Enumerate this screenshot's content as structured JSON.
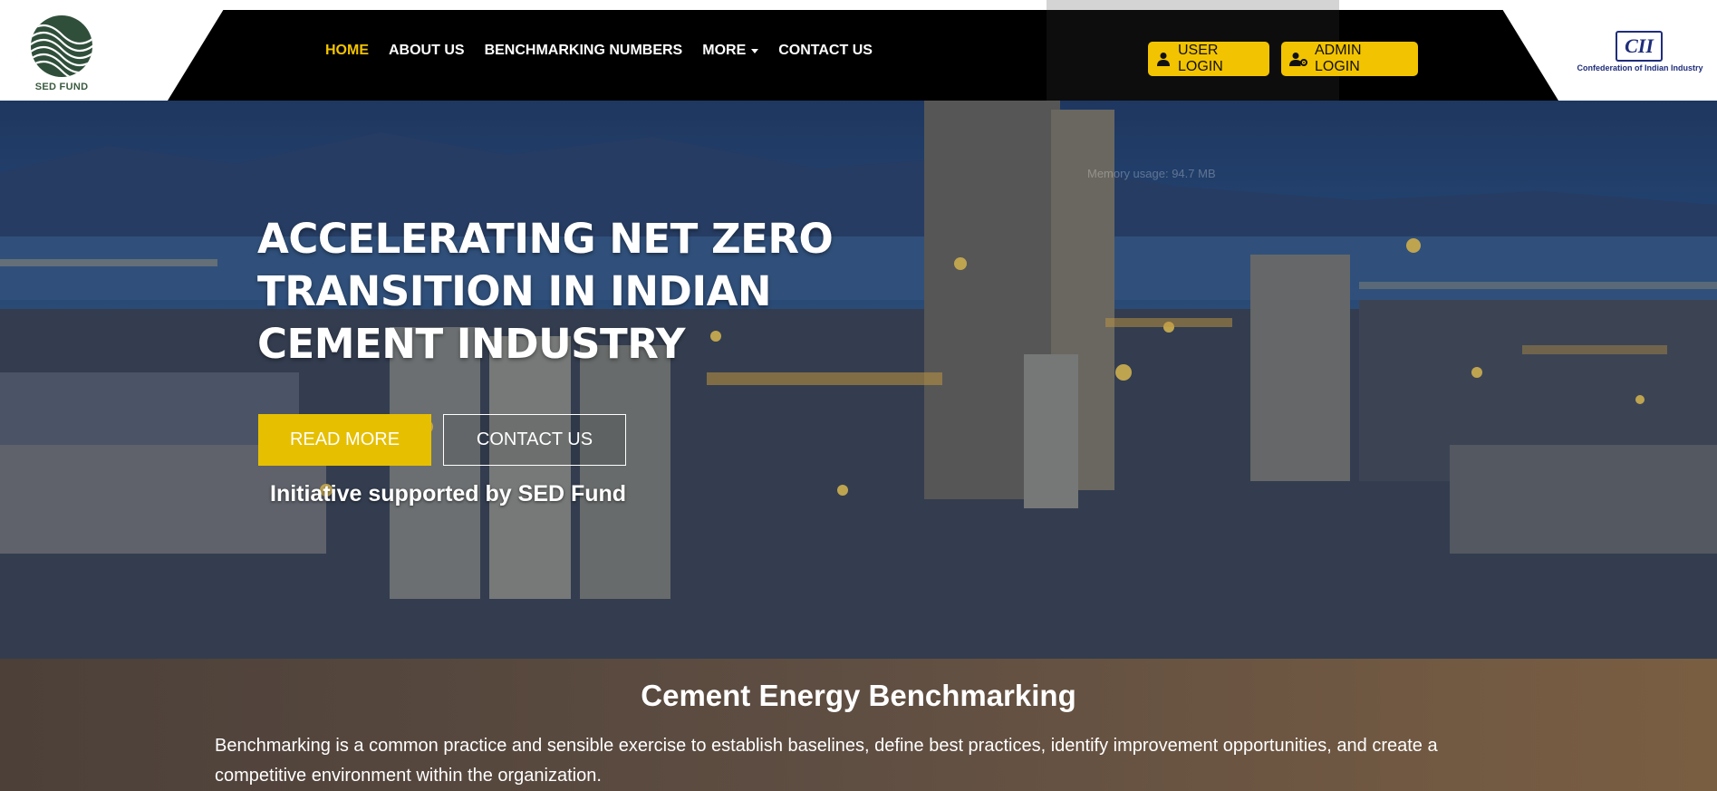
{
  "brand": {
    "sed_logo_label": "SED FUND",
    "cii_logo_mark": "CII",
    "cii_logo_label": "Confederation of Indian Industry"
  },
  "nav": {
    "items": [
      {
        "label": "HOME",
        "active": true
      },
      {
        "label": "ABOUT US",
        "active": false
      },
      {
        "label": "BENCHMARKING NUMBERS",
        "active": false
      },
      {
        "label": "MORE",
        "active": false,
        "has_dropdown": true
      },
      {
        "label": "CONTACT US",
        "active": false
      }
    ]
  },
  "auth": {
    "user_login": "USER LOGIN",
    "admin_login": "ADMIN LOGIN"
  },
  "overlay": {
    "memory_usage": "Memory usage: 94.7 MB"
  },
  "hero": {
    "title": "ACCELERATING NET ZERO TRANSITION IN INDIAN CEMENT INDUSTRY",
    "read_more": "READ MORE",
    "contact_us": "CONTACT US",
    "initiative": "Initiative supported by SED Fund"
  },
  "benchmarking": {
    "title": "Cement Energy Benchmarking",
    "description": "Benchmarking is a common practice and sensible exercise to establish baselines, define best practices, identify improvement opportunities, and create a competitive environment within the organization."
  },
  "colors": {
    "accent": "#f2c300",
    "nav_bg": "#000000",
    "cii_blue": "#1f2d7a",
    "section_bg": "#5f4e42"
  },
  "icons": {
    "user_login": "user-icon",
    "admin_login": "user-gear-icon"
  }
}
